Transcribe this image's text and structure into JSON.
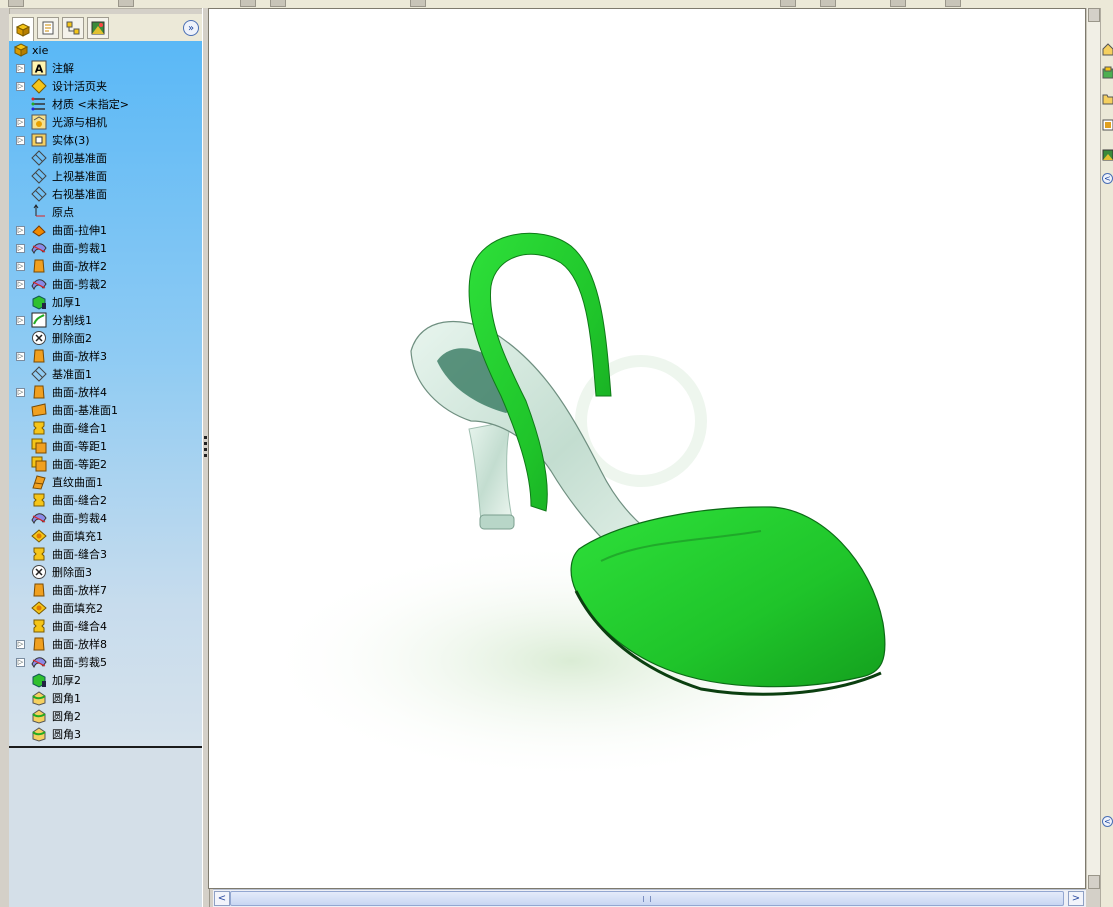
{
  "feature_manager": {
    "tabs": [
      "feature-manager",
      "property-manager",
      "configuration-manager",
      "display-manager"
    ],
    "expand_label": "»",
    "root": "xie",
    "items": [
      {
        "label": "注解",
        "icon": "annotation-icon",
        "expandable": true
      },
      {
        "label": "设计活页夹",
        "icon": "design-binder-icon",
        "expandable": true
      },
      {
        "label": "材质 <未指定>",
        "icon": "material-icon",
        "expandable": false
      },
      {
        "label": "光源与相机",
        "icon": "lights-camera-icon",
        "expandable": true
      },
      {
        "label": "实体(3)",
        "icon": "solid-bodies-icon",
        "expandable": true
      },
      {
        "label": "前视基准面",
        "icon": "plane-icon",
        "expandable": false
      },
      {
        "label": "上视基准面",
        "icon": "plane-icon",
        "expandable": false
      },
      {
        "label": "右视基准面",
        "icon": "plane-icon",
        "expandable": false
      },
      {
        "label": "原点",
        "icon": "origin-icon",
        "expandable": false
      },
      {
        "label": "曲面-拉伸1",
        "icon": "surface-extrude-icon",
        "expandable": true
      },
      {
        "label": "曲面-剪裁1",
        "icon": "surface-trim-icon",
        "expandable": true
      },
      {
        "label": "曲面-放样2",
        "icon": "surface-loft-icon",
        "expandable": true
      },
      {
        "label": "曲面-剪裁2",
        "icon": "surface-trim-icon",
        "expandable": true
      },
      {
        "label": "加厚1",
        "icon": "thicken-icon",
        "expandable": false
      },
      {
        "label": "分割线1",
        "icon": "split-line-icon",
        "expandable": true
      },
      {
        "label": "删除面2",
        "icon": "delete-face-icon",
        "expandable": false
      },
      {
        "label": "曲面-放样3",
        "icon": "surface-loft-icon",
        "expandable": true
      },
      {
        "label": "基准面1",
        "icon": "plane-icon",
        "expandable": false
      },
      {
        "label": "曲面-放样4",
        "icon": "surface-loft-icon",
        "expandable": true
      },
      {
        "label": "曲面-基准面1",
        "icon": "planar-surface-icon",
        "expandable": false
      },
      {
        "label": "曲面-缝合1",
        "icon": "surface-knit-icon",
        "expandable": false
      },
      {
        "label": "曲面-等距1",
        "icon": "surface-offset-icon",
        "expandable": false
      },
      {
        "label": "曲面-等距2",
        "icon": "surface-offset-icon",
        "expandable": false
      },
      {
        "label": "直纹曲面1",
        "icon": "ruled-surface-icon",
        "expandable": false
      },
      {
        "label": "曲面-缝合2",
        "icon": "surface-knit-icon",
        "expandable": false
      },
      {
        "label": "曲面-剪裁4",
        "icon": "surface-trim-icon",
        "expandable": false
      },
      {
        "label": "曲面填充1",
        "icon": "fill-surface-icon",
        "expandable": false
      },
      {
        "label": "曲面-缝合3",
        "icon": "surface-knit-icon",
        "expandable": false
      },
      {
        "label": "删除面3",
        "icon": "delete-face-icon",
        "expandable": false
      },
      {
        "label": "曲面-放样7",
        "icon": "surface-loft-icon",
        "expandable": false
      },
      {
        "label": "曲面填充2",
        "icon": "fill-surface-icon",
        "expandable": false
      },
      {
        "label": "曲面-缝合4",
        "icon": "surface-knit-icon",
        "expandable": false
      },
      {
        "label": "曲面-放样8",
        "icon": "surface-loft-icon",
        "expandable": true
      },
      {
        "label": "曲面-剪裁5",
        "icon": "surface-trim-icon",
        "expandable": true
      },
      {
        "label": "加厚2",
        "icon": "thicken-icon",
        "expandable": false
      },
      {
        "label": "圆角1",
        "icon": "fillet-icon",
        "expandable": false
      },
      {
        "label": "圆角2",
        "icon": "fillet-icon",
        "expandable": false
      },
      {
        "label": "圆角3",
        "icon": "fillet-icon",
        "expandable": false
      }
    ]
  },
  "viewport": {
    "model": "green-high-heel-shoe",
    "colors": {
      "shoe_green": "#22c52a",
      "glass": "#cfe6dc",
      "shadow": "#e6f2e0"
    }
  },
  "scrollbars": {
    "left_arrow": "<",
    "right_arrow": ">",
    "grip": "|||"
  },
  "task_pane": {
    "icons": [
      "home-icon",
      "design-library-icon",
      "file-explorer-icon",
      "view-palette-icon",
      "appearances-icon"
    ]
  }
}
